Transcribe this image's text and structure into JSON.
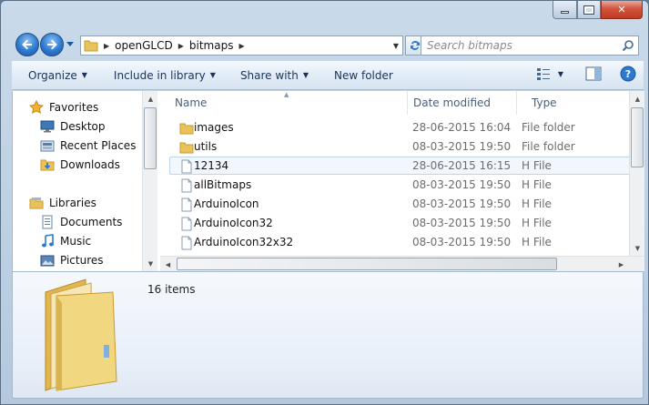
{
  "window": {
    "caption_buttons": {
      "minimize": "minimize-icon",
      "maximize": "maximize-icon",
      "close": "close-icon"
    }
  },
  "navigation": {
    "breadcrumbs": [
      "openGLCD",
      "bitmaps"
    ],
    "search_placeholder": "Search bitmaps"
  },
  "toolbar": {
    "organize": "Organize",
    "include_in_library": "Include in library",
    "share_with": "Share with",
    "new_folder": "New folder"
  },
  "sidebar": {
    "favorites_label": "Favorites",
    "favorites": [
      {
        "label": "Desktop",
        "icon": "desktop-icon"
      },
      {
        "label": "Recent Places",
        "icon": "recent-places-icon"
      },
      {
        "label": "Downloads",
        "icon": "downloads-icon"
      }
    ],
    "libraries_label": "Libraries",
    "libraries": [
      {
        "label": "Documents",
        "icon": "documents-icon"
      },
      {
        "label": "Music",
        "icon": "music-icon"
      },
      {
        "label": "Pictures",
        "icon": "pictures-icon"
      }
    ]
  },
  "file_list": {
    "columns": [
      "Name",
      "Date modified",
      "Type"
    ],
    "rows": [
      {
        "name": "images",
        "date": "28-06-2015 16:04",
        "type": "File folder",
        "kind": "folder"
      },
      {
        "name": "utils",
        "date": "08-03-2015 19:50",
        "type": "File folder",
        "kind": "folder"
      },
      {
        "name": "12134",
        "date": "28-06-2015 16:15",
        "type": "H File",
        "kind": "file",
        "selected": true
      },
      {
        "name": "allBitmaps",
        "date": "08-03-2015 19:50",
        "type": "H File",
        "kind": "file"
      },
      {
        "name": "ArduinoIcon",
        "date": "08-03-2015 19:50",
        "type": "H File",
        "kind": "file"
      },
      {
        "name": "ArduinoIcon32",
        "date": "08-03-2015 19:50",
        "type": "H File",
        "kind": "file"
      },
      {
        "name": "ArduinoIcon32x32",
        "date": "08-03-2015 19:50",
        "type": "H File",
        "kind": "file"
      }
    ]
  },
  "details": {
    "item_count": "16 items"
  },
  "colors": {
    "folder": "#e9c35a",
    "folder_dark": "#c99a2e",
    "selection_border": "#bcd6ef",
    "toolbar_text": "#1e3257"
  }
}
